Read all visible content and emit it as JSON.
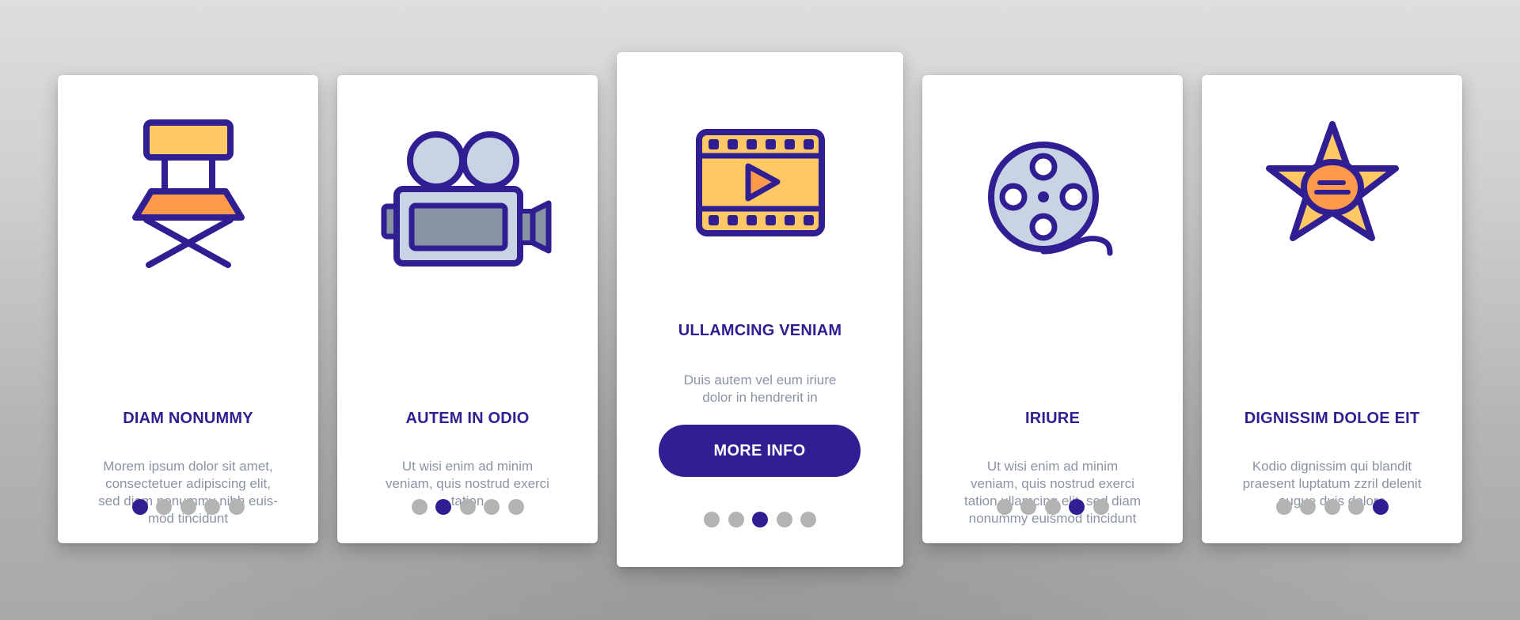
{
  "colors": {
    "primary": "#2f1f93",
    "dot_inactive": "#b3b3b3",
    "text_body": "#8a94a6",
    "yellow": "#ffc864",
    "orange": "#ff9a4d",
    "light_blue": "#c8d3e4",
    "slate": "#8593a3"
  },
  "cards": [
    {
      "icon": "directors-chair-icon",
      "title": "DIAM NONUMMY",
      "description": "Morem ipsum dolor sit amet, consectetuer adipiscing elit, sed diam nonummy nibh euis-mod tincidunt",
      "description_lines": [
        "Morem ipsum dolor sit amet,",
        "consectetuer adipiscing elit,",
        "sed diam nonummy nibh euis-",
        "mod tincidunt"
      ],
      "active_dot": 1
    },
    {
      "icon": "movie-camera-icon",
      "title": "AUTEM IN ODIO",
      "description_lines": [
        "Ut wisi enim ad minim",
        "veniam, quis nostrud exerci",
        "tation"
      ],
      "active_dot": 2
    },
    {
      "icon": "film-strip-play-icon",
      "title": "ULLAMCING VENIAM",
      "description_lines": [
        "Duis autem vel eum iriure",
        "dolor in hendrerit in"
      ],
      "button_label": "MORE INFO",
      "active_dot": 3
    },
    {
      "icon": "film-reel-icon",
      "title": "IRIURE",
      "description_lines": [
        "Ut wisi enim ad minim",
        "veniam, quis nostrud exerci",
        "tation ullamcing elit, sed diam",
        "nonummy euismod tincidunt"
      ],
      "active_dot": 4
    },
    {
      "icon": "star-badge-icon",
      "title": "DIGNISSIM DOLOE EIT",
      "description_lines": [
        "Kodio dignissim qui blandit",
        "praesent luptatum zzril delenit",
        "augue duis dolore"
      ],
      "active_dot": 5
    }
  ],
  "pagination": {
    "total_dots": 5
  }
}
